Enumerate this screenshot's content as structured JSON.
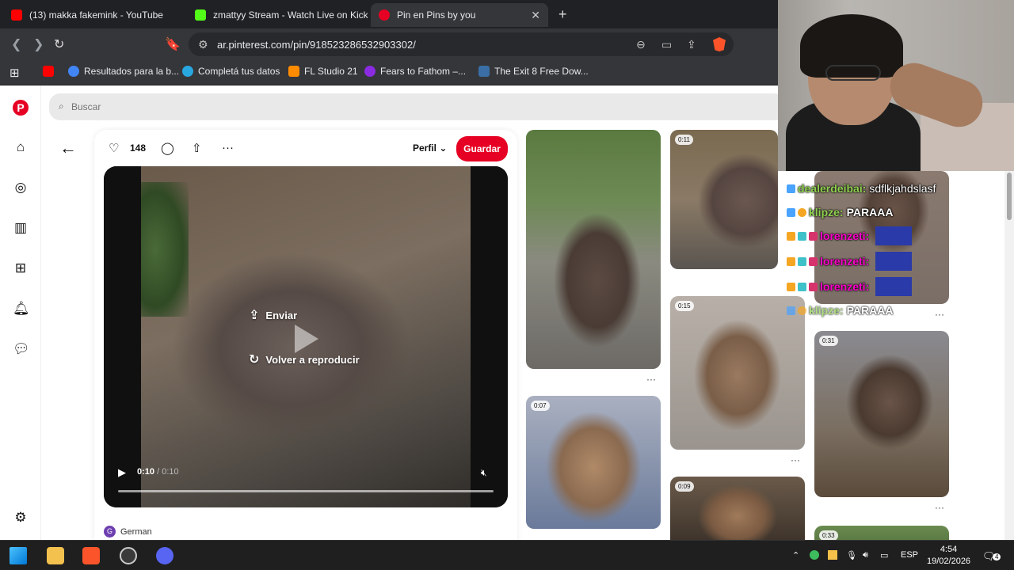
{
  "browser": {
    "tabs": [
      {
        "label": "(13) makka fakemink - YouTube",
        "color": "#ff0000"
      },
      {
        "label": "zmattyy Stream - Watch Live on Kick",
        "color": "#53fc18"
      },
      {
        "label": "Pin en Pins by you",
        "color": "#e60023"
      }
    ],
    "new_tab": "+",
    "close": "✕",
    "url": "ar.pinterest.com/pin/918523286532903302/",
    "bookmarks": [
      {
        "label": "",
        "color": "#ff0000"
      },
      {
        "label": "Resultados para la b...",
        "color": "#4285f4"
      },
      {
        "label": "Completá tus datos",
        "color": "#29a7e1"
      },
      {
        "label": "FL Studio 21",
        "color": "#ff8c00"
      },
      {
        "label": "Fears to Fathom –...",
        "color": "#8a2be2"
      },
      {
        "label": "The Exit 8 Free Dow...",
        "color": "#3a6ea5"
      }
    ]
  },
  "search": {
    "placeholder": "Buscar"
  },
  "pin": {
    "likes": "148",
    "profile": "Perfil",
    "save": "Guardar",
    "send": "Enviar",
    "replay": "Volver a reproducir",
    "time_current": "0:10",
    "time_total": " / 0:10",
    "progress": 1.0,
    "author": "German",
    "author_initial": "G"
  },
  "feed": {
    "durations": [
      "0:11",
      "0:15",
      "0:07",
      "0:09",
      "0:31",
      "0:33"
    ],
    "more": "···"
  },
  "chat": [
    {
      "user": "dealerdeibai:",
      "msg": "sdflkjahdslasf"
    },
    {
      "user": "klipze:",
      "msg": "PARAAA"
    },
    {
      "user": "lorenzeti:",
      "msg": ""
    },
    {
      "user": "lorenzeti:",
      "msg": ""
    },
    {
      "user": "lorenzeti:",
      "msg": ""
    },
    {
      "user": "klipze:",
      "msg": "PARAAA"
    }
  ],
  "taskbar": {
    "language": "ESP",
    "time": "4:54",
    "date": "19/02/2026",
    "notifications": "4"
  },
  "colors": {
    "brand": "#e60023",
    "chat_user": "#8fd14f"
  }
}
